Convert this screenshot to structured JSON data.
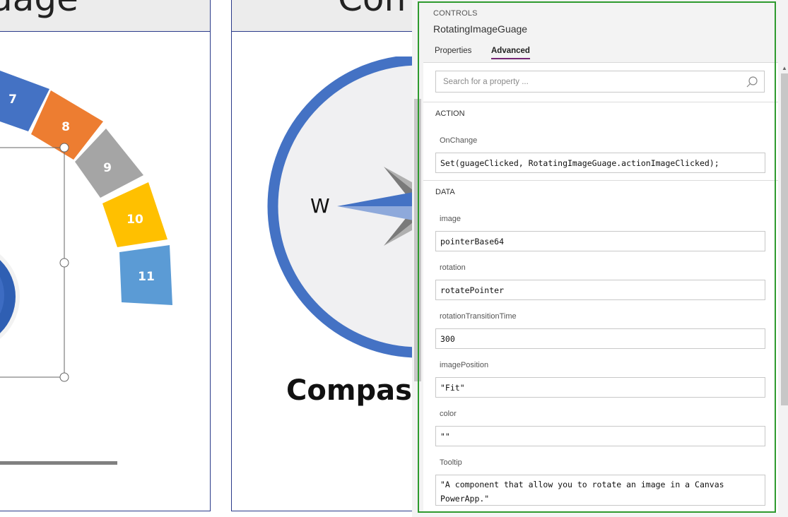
{
  "canvas": {
    "gauge_card_title": "uage",
    "compass_card_title": "Com",
    "gauge_segments": [
      "7",
      "8",
      "9",
      "10",
      "11"
    ],
    "compass_direction_west": "W",
    "compass_label": "Compass"
  },
  "colors": {
    "segment_blue": "#4472c4",
    "segment_orange": "#ed7d31",
    "segment_gray": "#a5a5a5",
    "segment_yellow": "#ffc000",
    "segment_lightblue": "#5b9bd5",
    "compass_ring": "#4472c4",
    "tab_underline": "#742774",
    "selection_border": "#2e9a2e"
  },
  "panel": {
    "section_label": "CONTROLS",
    "control_name": "RotatingImageGuage",
    "tabs": [
      {
        "label": "Properties",
        "active": false
      },
      {
        "label": "Advanced",
        "active": true
      }
    ],
    "search_placeholder": "Search for a property ...",
    "sections": {
      "action": {
        "title": "ACTION",
        "props": [
          {
            "label": "OnChange",
            "value": "Set(guageClicked, RotatingImageGuage.actionImageClicked);"
          }
        ]
      },
      "data": {
        "title": "DATA",
        "props": [
          {
            "label": "image",
            "value": "pointerBase64"
          },
          {
            "label": "rotation",
            "value": "rotatePointer"
          },
          {
            "label": "rotationTransitionTime",
            "value": "300"
          },
          {
            "label": "imagePosition",
            "value": "\"Fit\""
          },
          {
            "label": "color",
            "value": "\"\""
          },
          {
            "label": "Tooltip",
            "value": "\"A component that allow you to rotate an image in a Canvas PowerApp.\""
          }
        ]
      }
    }
  }
}
